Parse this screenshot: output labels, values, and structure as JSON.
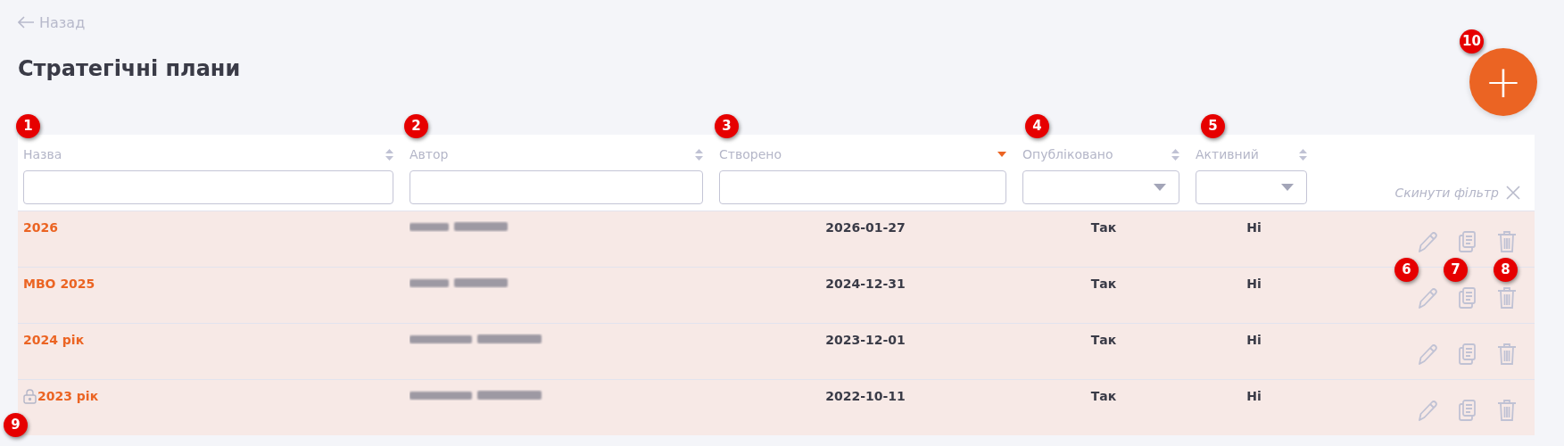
{
  "back_link": {
    "label": "Назад"
  },
  "title": "Стратегічні плани",
  "add_button": {
    "label": "+"
  },
  "table": {
    "columns": [
      {
        "label": "Назва",
        "sorted": false,
        "filter": {
          "kind": "text"
        }
      },
      {
        "label": "Автор",
        "sorted": false,
        "filter": {
          "kind": "text"
        }
      },
      {
        "label": "Створено",
        "sorted": true,
        "filter": {
          "kind": "text"
        }
      },
      {
        "label": "Опубліковано",
        "sorted": false,
        "filter": {
          "kind": "select"
        }
      },
      {
        "label": "Активний",
        "sorted": false,
        "filter": {
          "kind": "select"
        }
      }
    ],
    "reset_filter": "Скинути фільтр",
    "rows": [
      {
        "name": "2026",
        "locked": false,
        "created": "2026-01-27",
        "published": "Так",
        "active": "Ні"
      },
      {
        "name": "MBO 2025",
        "locked": false,
        "created": "2024-12-31",
        "published": "Так",
        "active": "Ні"
      },
      {
        "name": "2024 рік",
        "locked": false,
        "created": "2023-12-01",
        "published": "Так",
        "active": "Ні"
      },
      {
        "name": "2023 рік",
        "locked": true,
        "created": "2022-10-11",
        "published": "Так",
        "active": "Ні"
      }
    ]
  },
  "callouts": [
    "1",
    "2",
    "3",
    "4",
    "5",
    "6",
    "7",
    "8",
    "9",
    "10"
  ]
}
